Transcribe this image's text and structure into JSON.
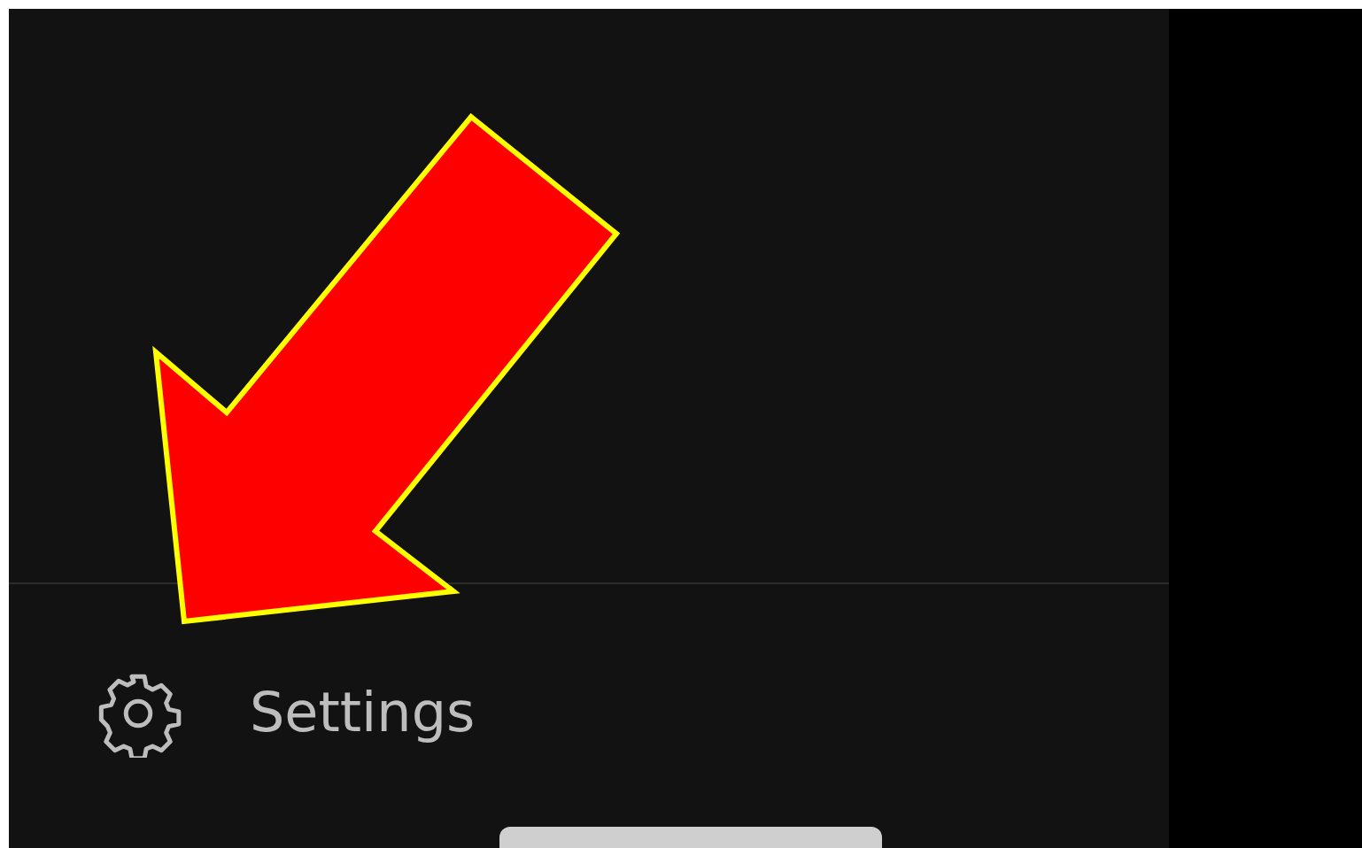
{
  "drawer": {
    "items": [
      {
        "label": "Settings"
      }
    ]
  }
}
